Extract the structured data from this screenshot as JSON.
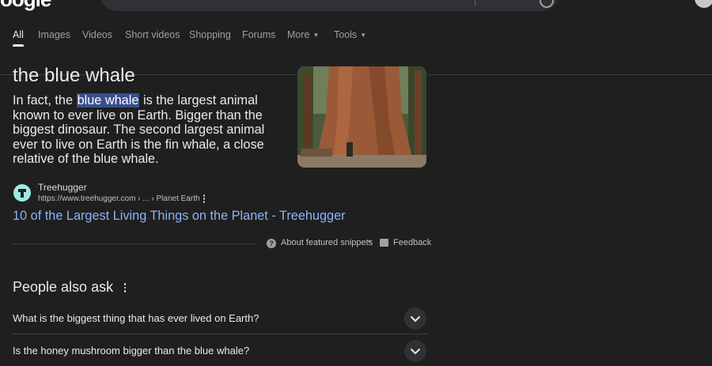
{
  "tabs": [
    {
      "label": "All",
      "active": true
    },
    {
      "label": "Images"
    },
    {
      "label": "Videos"
    },
    {
      "label": "Short videos"
    },
    {
      "label": "Shopping"
    },
    {
      "label": "Forums"
    },
    {
      "label": "More",
      "dropdown": true
    },
    {
      "label": "Tools",
      "dropdown": true
    }
  ],
  "snippet": {
    "title": "the blue whale",
    "text_before": "In fact, the ",
    "highlight": "blue whale",
    "text_after": " is the largest animal known to ever live on Earth. Bigger than the biggest dinosaur. The second largest animal ever to live on Earth is the fin whale, a close relative of the blue whale.",
    "source_name": "Treehugger",
    "source_url": "https://www.treehugger.com › ... › Planet Earth",
    "link_text": "10 of the Largest Living Things on the Planet - Treehugger",
    "about_label": "About featured snippets",
    "separator": "•",
    "feedback_label": "Feedback"
  },
  "people_also_ask": {
    "title": "People also ask",
    "questions": [
      "What is the biggest thing that has ever lived on Earth?",
      "Is the honey mushroom bigger than the blue whale?"
    ]
  },
  "colors": {
    "background": "#1f1f1f",
    "link": "#8ab4f8",
    "highlight": "#394e8a",
    "text": "#e8eaed",
    "muted": "#9aa0a6"
  },
  "icons": [
    "apps-icon",
    "more-vert-icon",
    "help-icon",
    "feedback-icon",
    "chevron-down-icon",
    "favicon-treehugger"
  ]
}
